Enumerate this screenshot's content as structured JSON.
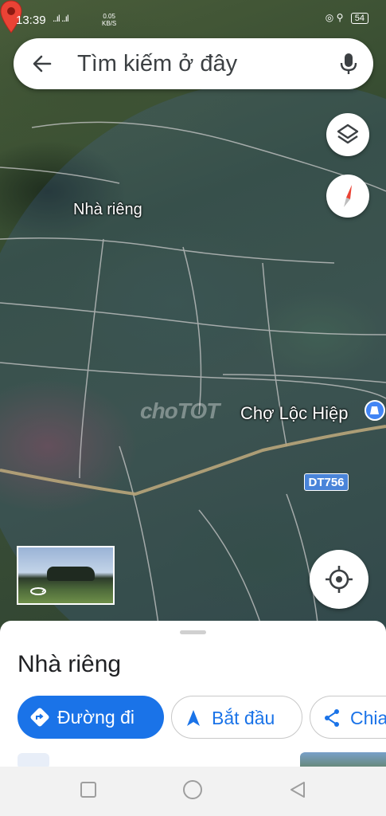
{
  "status_bar": {
    "time": "13:39",
    "signal": "..ıl ..ıl",
    "net_speed_value": "0.05",
    "net_speed_unit": "KB/S",
    "battery": "54"
  },
  "search": {
    "placeholder": "Tìm kiếm ở đây"
  },
  "map": {
    "pin_label": "Nhà riêng",
    "poi_label": "Chợ Lộc Hiệp",
    "road_label": "DT756",
    "watermark": "choTOT"
  },
  "sheet": {
    "title": "Nhà riêng",
    "directions_label": "Đường đi",
    "start_label": "Bắt đầu",
    "share_label": "Chia"
  },
  "colors": {
    "accent": "#1a73e8",
    "pin": "#ea4335",
    "road_badge": "#4a84d9"
  },
  "icons": {
    "back": "arrow-left-icon",
    "mic": "microphone-icon",
    "layers": "layers-icon",
    "compass": "compass-icon",
    "locate": "my-location-icon",
    "directions": "directions-icon",
    "start": "navigation-arrow-icon",
    "share": "share-icon",
    "street_view": "street-view-icon"
  }
}
